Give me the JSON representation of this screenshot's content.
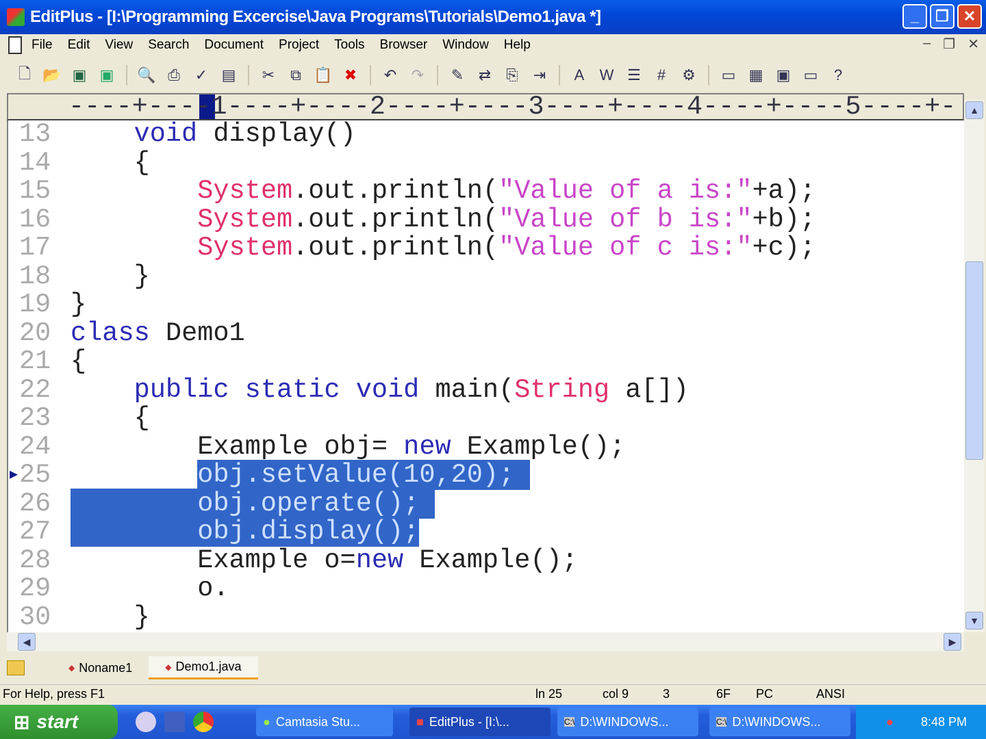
{
  "window": {
    "title": "EditPlus - [I:\\Programming Excercise\\Java Programs\\Tutorials\\Demo1.java *]"
  },
  "menu": [
    "File",
    "Edit",
    "View",
    "Search",
    "Document",
    "Project",
    "Tools",
    "Browser",
    "Window",
    "Help"
  ],
  "ruler": "----+----1----+----2----+----3----+----4----+----5----+-",
  "editor": {
    "lines": [
      {
        "n": "13",
        "t": [
          [
            "    ",
            "pl"
          ],
          [
            "void",
            "kw"
          ],
          [
            " display()",
            "pl"
          ]
        ]
      },
      {
        "n": "14",
        "t": [
          [
            "    {",
            "pl"
          ]
        ]
      },
      {
        "n": "15",
        "t": [
          [
            "        ",
            "pl"
          ],
          [
            "System",
            "cls"
          ],
          [
            ".out.println(",
            "pl"
          ],
          [
            "\"Value of a is:\"",
            "str"
          ],
          [
            "+a);",
            "pl"
          ]
        ]
      },
      {
        "n": "16",
        "t": [
          [
            "        ",
            "pl"
          ],
          [
            "System",
            "cls"
          ],
          [
            ".out.println(",
            "pl"
          ],
          [
            "\"Value of b is:\"",
            "str"
          ],
          [
            "+b);",
            "pl"
          ]
        ]
      },
      {
        "n": "17",
        "t": [
          [
            "        ",
            "pl"
          ],
          [
            "System",
            "cls"
          ],
          [
            ".out.println(",
            "pl"
          ],
          [
            "\"Value of c is:\"",
            "str"
          ],
          [
            "+c);",
            "pl"
          ]
        ]
      },
      {
        "n": "18",
        "t": [
          [
            "    }",
            "pl"
          ]
        ]
      },
      {
        "n": "19",
        "t": [
          [
            "}",
            "pl"
          ]
        ]
      },
      {
        "n": "20",
        "t": [
          [
            "class",
            "kw"
          ],
          [
            " Demo1",
            "pl"
          ]
        ]
      },
      {
        "n": "21",
        "t": [
          [
            "{",
            "pl"
          ]
        ]
      },
      {
        "n": "22",
        "t": [
          [
            "    ",
            "pl"
          ],
          [
            "public static void",
            "kw"
          ],
          [
            " main(",
            "pl"
          ],
          [
            "String",
            "cls"
          ],
          [
            " a[])",
            "pl"
          ]
        ]
      },
      {
        "n": "23",
        "t": [
          [
            "    {",
            "pl"
          ]
        ]
      },
      {
        "n": "24",
        "t": [
          [
            "        Example obj= ",
            "pl"
          ],
          [
            "new",
            "kw"
          ],
          [
            " Example();",
            "pl"
          ]
        ]
      },
      {
        "n": "25",
        "t": [
          [
            "        ",
            "pl"
          ],
          [
            "obj.setValue(10,20); ",
            "sel"
          ]
        ]
      },
      {
        "n": "26",
        "t": [
          [
            "        obj.operate(); ",
            "sel"
          ]
        ]
      },
      {
        "n": "27",
        "t": [
          [
            "        obj.display();",
            "sel"
          ]
        ]
      },
      {
        "n": "28",
        "t": [
          [
            "        Example o=",
            "pl"
          ],
          [
            "new",
            "kw"
          ],
          [
            " Example();",
            "pl"
          ]
        ]
      },
      {
        "n": "29",
        "t": [
          [
            "        o.",
            "pl"
          ]
        ]
      },
      {
        "n": "30",
        "t": [
          [
            "    }",
            "pl"
          ]
        ]
      }
    ]
  },
  "tabs": [
    "Noname1",
    "Demo1.java"
  ],
  "status": {
    "help": "For Help, press F1",
    "ln": "ln 25",
    "col": "col 9",
    "sel": "3",
    "code": "6F",
    "mode": "PC",
    "enc": "ANSI"
  },
  "taskbar": {
    "start": "start",
    "tasks": [
      "Camtasia Stu...",
      "EditPlus - [I:\\...",
      "D:\\WINDOWS...",
      "D:\\WINDOWS..."
    ],
    "clock": "8:48 PM"
  }
}
